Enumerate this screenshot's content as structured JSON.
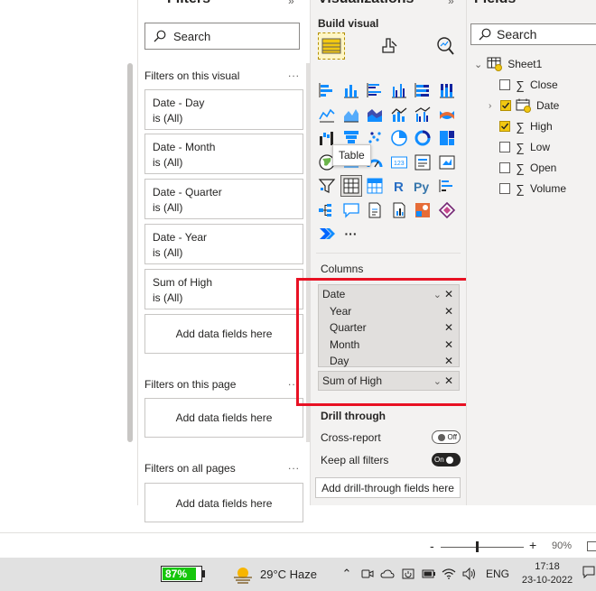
{
  "filters": {
    "title": "Filters",
    "search_placeholder": "Search",
    "on_visual_label": "Filters on this visual",
    "visual_filters": [
      {
        "name": "Date - Day",
        "value": "is (All)"
      },
      {
        "name": "Date - Month",
        "value": "is (All)"
      },
      {
        "name": "Date - Quarter",
        "value": "is (All)"
      },
      {
        "name": "Date - Year",
        "value": "is (All)"
      },
      {
        "name": "Sum of High",
        "value": "is (All)"
      }
    ],
    "add_fields": "Add data fields here",
    "on_page_label": "Filters on this page",
    "on_all_pages_label": "Filters on all pages",
    "more": "..."
  },
  "visualizations": {
    "title": "Visualizations",
    "build_visual": "Build visual",
    "tooltip": "Table",
    "more_visuals": "···",
    "columns_label": "Columns",
    "column_group": {
      "name": "Date",
      "children": [
        "Year",
        "Quarter",
        "Month",
        "Day"
      ]
    },
    "column_single": "Sum of High",
    "drill_through": "Drill through",
    "cross_report": "Cross-report",
    "cross_report_state": "Off",
    "keep_all_filters": "Keep all filters",
    "keep_all_filters_state": "On",
    "add_drill": "Add drill-through fields here"
  },
  "fields": {
    "title": "Fields",
    "search_placeholder": "Search",
    "table_name": "Sheet1",
    "items": [
      {
        "name": "Close",
        "kind": "sigma",
        "checked": false
      },
      {
        "name": "Date",
        "kind": "date",
        "checked": true
      },
      {
        "name": "High",
        "kind": "sigma",
        "checked": true
      },
      {
        "name": "Low",
        "kind": "sigma",
        "checked": false
      },
      {
        "name": "Open",
        "kind": "sigma",
        "checked": false
      },
      {
        "name": "Volume",
        "kind": "sigma",
        "checked": false
      }
    ]
  },
  "status_bar": {
    "zoom_minus": "-",
    "zoom_plus": "+",
    "zoom_level": "90%"
  },
  "taskbar": {
    "battery": "87%",
    "weather": "29°C  Haze",
    "language": "ENG",
    "time": "17:18",
    "date": "23-10-2022"
  },
  "colors": {
    "accent_yellow": "#f2c811",
    "highlight_red": "#e81123",
    "battery_green": "#16c60c"
  }
}
